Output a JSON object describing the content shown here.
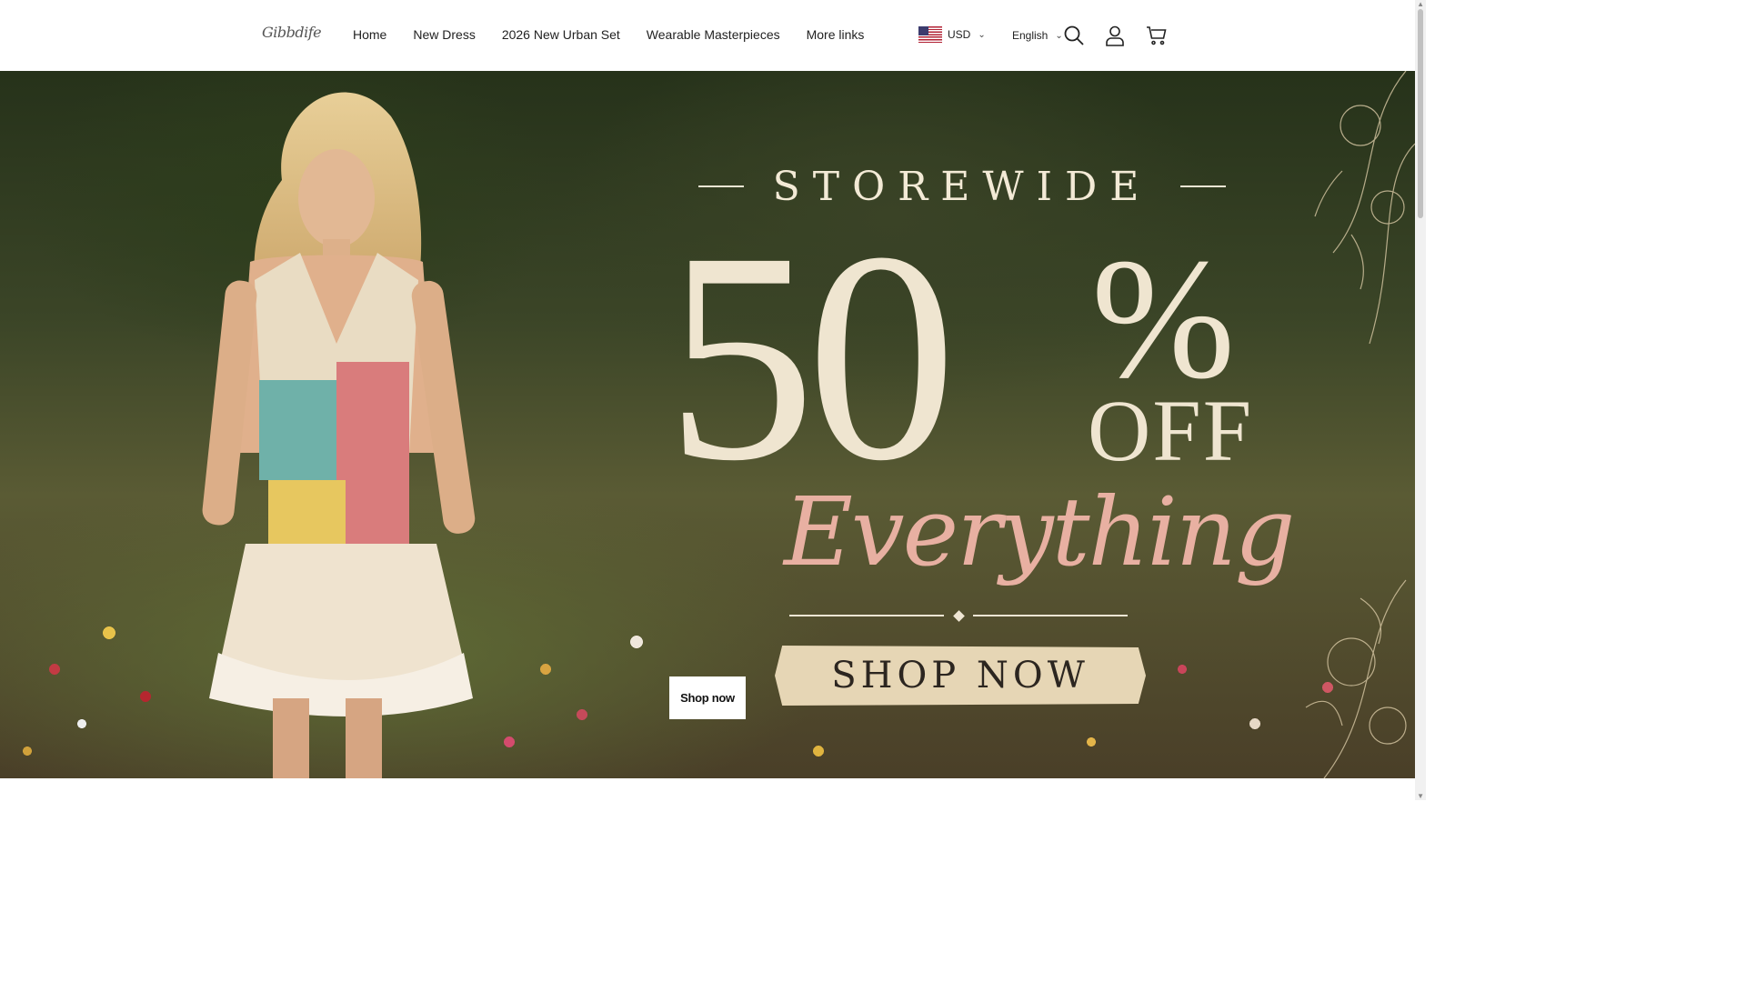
{
  "header": {
    "logo_text": "Gibbdife",
    "nav": [
      "Home",
      "New Dress",
      "2026 New Urban Set",
      "Wearable Masterpieces",
      "More links"
    ],
    "currency": "USD",
    "language": "English"
  },
  "hero": {
    "storewide": "STOREWIDE",
    "big_number": "50",
    "percent": "%",
    "off": "OFF",
    "everything": "Everything",
    "banner_text": "SHOP NOW",
    "button_label": "Shop now"
  },
  "icons": {
    "search": "search-icon",
    "account": "user-icon",
    "cart": "cart-icon",
    "flag": "us-flag-icon"
  }
}
